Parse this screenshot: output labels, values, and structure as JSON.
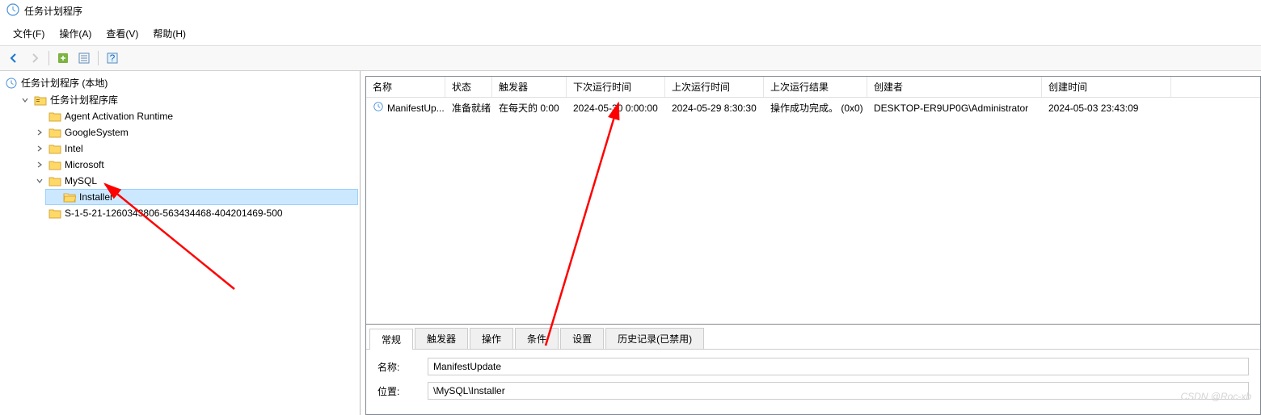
{
  "window": {
    "title": "任务计划程序"
  },
  "menu": {
    "file": "文件(F)",
    "action": "操作(A)",
    "view": "查看(V)",
    "help": "帮助(H)"
  },
  "tree": {
    "root": "任务计划程序 (本地)",
    "library": "任务计划程序库",
    "items": {
      "agent": "Agent Activation Runtime",
      "google": "GoogleSystem",
      "intel": "Intel",
      "microsoft": "Microsoft",
      "mysql": "MySQL",
      "installer": "Installer",
      "sid": "S-1-5-21-1260343806-563434468-404201469-500"
    }
  },
  "list": {
    "headers": {
      "name": "名称",
      "status": "状态",
      "trigger": "触发器",
      "next": "下次运行时间",
      "last": "上次运行时间",
      "result": "上次运行结果",
      "creator": "创建者",
      "created": "创建时间"
    },
    "rows": [
      {
        "name": "ManifestUp...",
        "status": "准备就绪",
        "trigger": "在每天的 0:00",
        "next": "2024-05-30 0:00:00",
        "last": "2024-05-29 8:30:30",
        "result": "操作成功完成。 (0x0)",
        "creator": "DESKTOP-ER9UP0G\\Administrator",
        "created": "2024-05-03 23:43:09"
      }
    ]
  },
  "details": {
    "tabs": {
      "general": "常规",
      "triggers": "触发器",
      "actions": "操作",
      "conditions": "条件",
      "settings": "设置",
      "history": "历史记录(已禁用)"
    },
    "fields": {
      "name_label": "名称:",
      "name_value": "ManifestUpdate",
      "location_label": "位置:",
      "location_value": "\\MySQL\\Installer"
    }
  },
  "watermark": "CSDN @Roc-xb"
}
